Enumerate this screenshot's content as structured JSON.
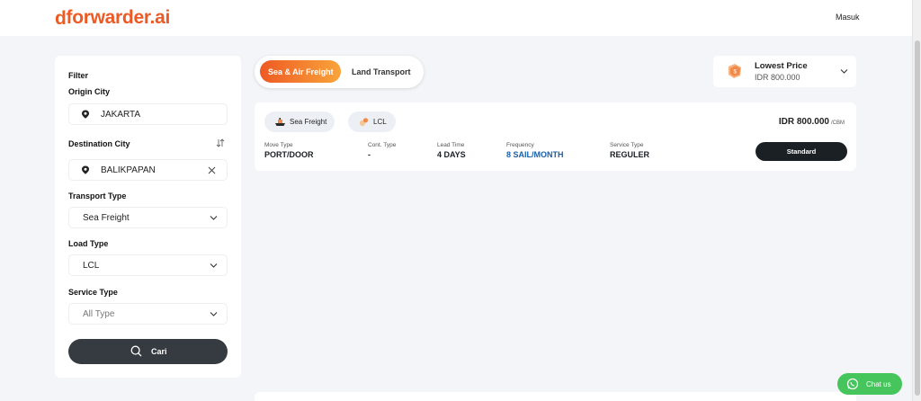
{
  "header": {
    "logo_mark": "d",
    "logo_text": "forwarder.ai",
    "login_label": "Masuk"
  },
  "filter": {
    "title": "Filter",
    "origin": {
      "label": "Origin City",
      "value": "JAKARTA"
    },
    "destination": {
      "label": "Destination City",
      "value": "BALIKPAPAN"
    },
    "transport_type": {
      "label": "Transport Type",
      "value": "Sea Freight"
    },
    "load_type": {
      "label": "Load Type",
      "value": "LCL"
    },
    "service_type": {
      "label": "Service Type",
      "placeholder": "All Type"
    },
    "search_label": "Cari"
  },
  "tabs": [
    {
      "label": "Sea & Air Freight",
      "active": true
    },
    {
      "label": "Land Transport",
      "active": false
    }
  ],
  "sort": {
    "label": "Lowest Price",
    "value": "IDR 800.000"
  },
  "result": {
    "mode": "Sea Freight",
    "load": "LCL",
    "price": "IDR 800.000",
    "price_unit": "/CBM",
    "details": [
      {
        "label": "Move Type",
        "value": "PORT/DOOR"
      },
      {
        "label": "Cont. Type",
        "value": "-"
      },
      {
        "label": "Lead Time",
        "value": "4 DAYS"
      },
      {
        "label": "Frequency",
        "value": "8 SAIL/MONTH"
      },
      {
        "label": "Service Type",
        "value": "REGULER"
      }
    ],
    "service_button": "Standard"
  },
  "chat": {
    "label": "Chat us"
  },
  "colors": {
    "brand": "#ee5a24",
    "brand_gradient_end": "#f9a43a",
    "dark_button": "#353b41",
    "frequency_blue": "#1a5fa3",
    "chat_green": "#46c55d"
  }
}
